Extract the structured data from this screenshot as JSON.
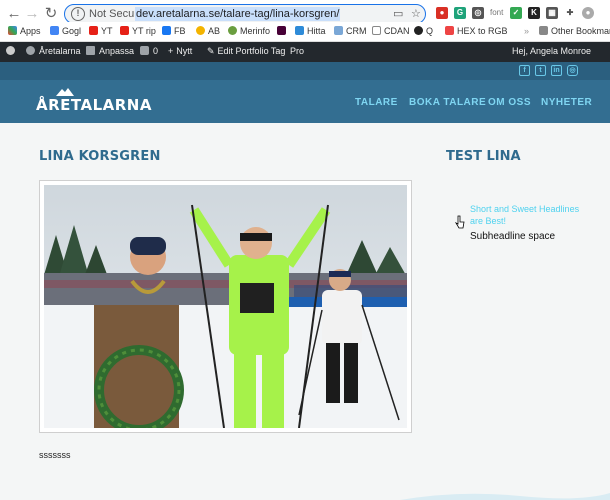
{
  "browser": {
    "not_secure_label": "Not Secure",
    "url": "dev.aretalarna.se/talare-tag/lina-korsgren/",
    "bookmarks": [
      "Apps",
      "Gogl",
      "YT",
      "YT rip",
      "FB",
      "AB",
      "Merinfo",
      "Hitta",
      "CRM",
      "CDAN",
      "Q",
      "HEX to RGB"
    ],
    "other_bookmarks": "Other Bookmarks"
  },
  "admin_bar": {
    "site_name": "Åretalarna",
    "customize": "Anpassa",
    "comments_count": "0",
    "new": "Nytt",
    "edit": "Edit Portfolio Tag",
    "pro": "Pro",
    "greeting": "Hej, Angela Monroe"
  },
  "site": {
    "logo_text": "ÅRETALARNA",
    "menu": [
      "TALARE",
      "BOKA TALARE",
      "OM OSS",
      "NYHETER"
    ],
    "social_icons": [
      "facebook-icon",
      "twitter-icon",
      "linkedin-icon",
      "instagram-icon"
    ]
  },
  "main": {
    "title": "LINA KORSGREN",
    "body_text": "sssssss"
  },
  "sidebar": {
    "title": "TEST LINA",
    "headline": "Short and Sweet Headlines are Best!",
    "subheadline": "Subheadline space"
  },
  "colors": {
    "header_bg": "#336e91",
    "accent": "#7fd6f2",
    "title": "#2f6b8e"
  }
}
